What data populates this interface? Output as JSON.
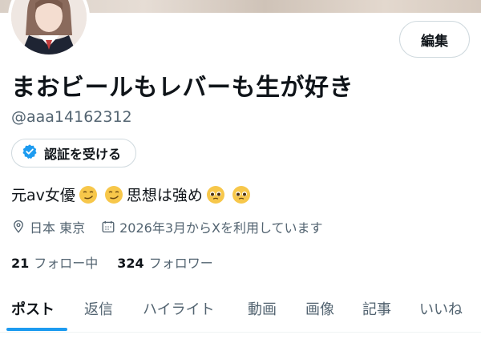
{
  "profile": {
    "display_name": "まおビールもレバーも生が好き",
    "handle": "@aaa14162312",
    "verify_label": "認証を受ける",
    "edit_label": "編集",
    "bio": {
      "part1": "元av女優",
      "part2": "思想は強め"
    },
    "location": "日本 東京",
    "joined": "2026年3月からXを利用しています",
    "following_count": "21",
    "following_label": "フォロー中",
    "followers_count": "324",
    "followers_label": "フォロワー"
  },
  "tabs": [
    {
      "label": "ポスト",
      "active": true
    },
    {
      "label": "返信"
    },
    {
      "label": "ハイライト"
    },
    {
      "label": "動画"
    },
    {
      "label": "画像"
    },
    {
      "label": "記事"
    },
    {
      "label": "いいね"
    }
  ],
  "icons": {
    "verify": "verified-badge-icon",
    "location": "location-pin-icon",
    "joined": "calendar-icon",
    "emoji_1": "smirking-face-emoji",
    "emoji_2": "pleading-face-emoji"
  },
  "colors": {
    "accent": "#1d9bf0",
    "text": "#0f1419",
    "muted": "#536471",
    "border": "#cfd9de"
  }
}
